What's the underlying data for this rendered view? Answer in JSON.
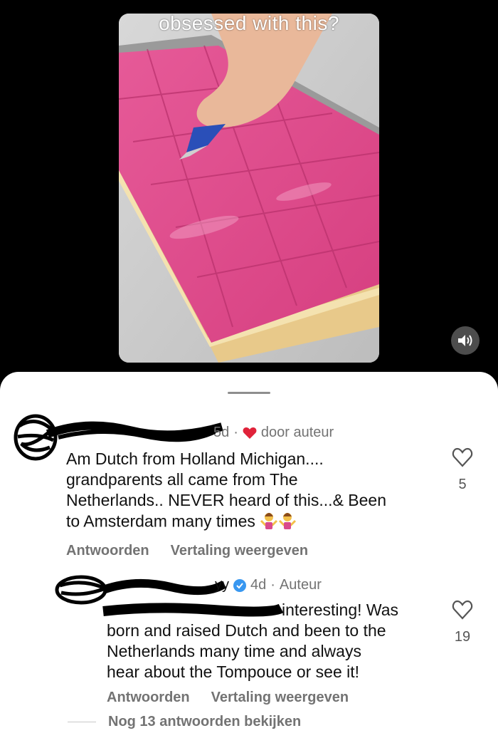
{
  "video": {
    "caption": "obsessed with this?"
  },
  "comments": [
    {
      "time": "5d",
      "liked_by_author_label": "door auteur",
      "text": "Am Dutch from Holland Michigan....\ngrandparents all came from The\nNetherlands.. NEVER heard of this...& Been\nto Amsterdam many times",
      "emojis": [
        "person-shrugging",
        "person-shrugging"
      ],
      "reply_label": "Antwoorden",
      "translate_label": "Vertaling weergeven",
      "like_count": "5"
    },
    {
      "username_tail": "yy",
      "verified": true,
      "time": "4d",
      "author_label": "Auteur",
      "text_tail": "interesting! Was",
      "text_rest": "born and raised Dutch and been to the\nNetherlands many time and always\nhear about the Tompouce or see it!",
      "reply_label": "Antwoorden",
      "translate_label": "Vertaling weergeven",
      "like_count": "19"
    }
  ],
  "more_replies_label": "Nog 13 antwoorden bekijken",
  "colors": {
    "background": "#000000",
    "sheet": "#ffffff",
    "heart_red": "#e0223a",
    "verified_blue": "#3897f0",
    "secondary_text": "#737373",
    "icing_pink": "#e2508f"
  }
}
